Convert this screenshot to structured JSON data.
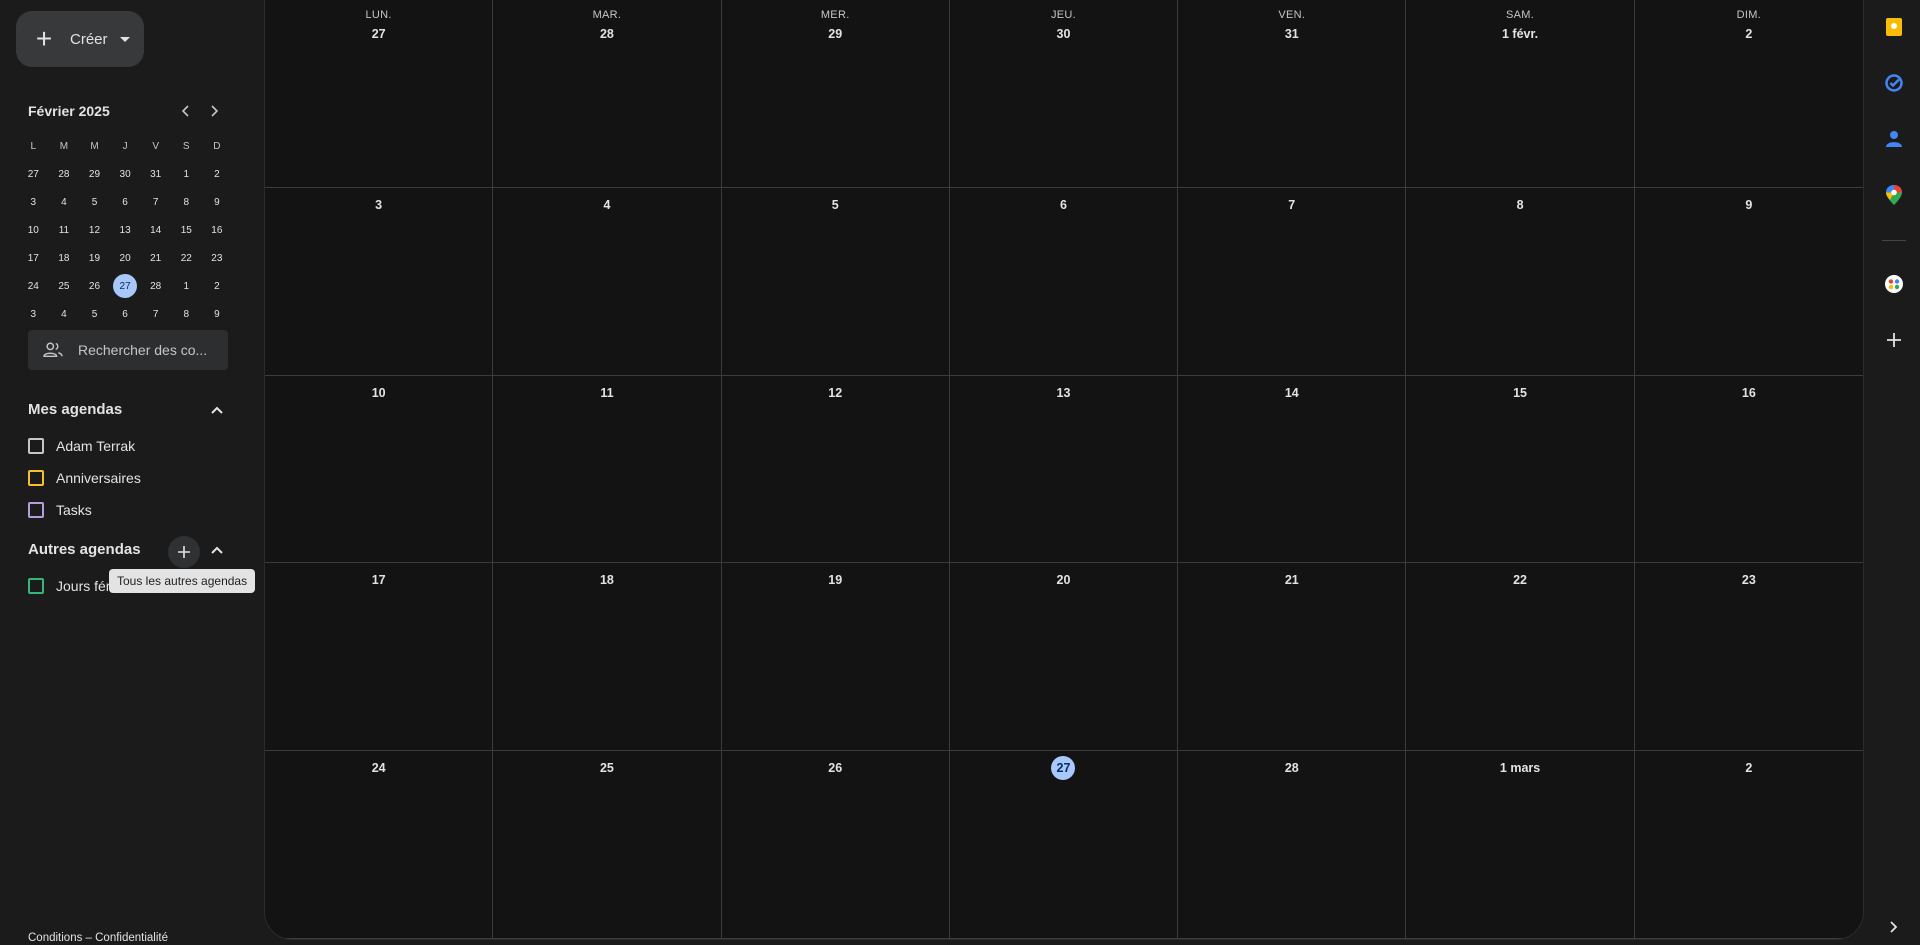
{
  "sidebar": {
    "create_label": "Créer",
    "mini": {
      "title": "Février 2025",
      "dows": [
        "L",
        "M",
        "M",
        "J",
        "V",
        "S",
        "D"
      ],
      "weeks": [
        [
          "27",
          "28",
          "29",
          "30",
          "31",
          "1",
          "2"
        ],
        [
          "3",
          "4",
          "5",
          "6",
          "7",
          "8",
          "9"
        ],
        [
          "10",
          "11",
          "12",
          "13",
          "14",
          "15",
          "16"
        ],
        [
          "17",
          "18",
          "19",
          "20",
          "21",
          "22",
          "23"
        ],
        [
          "24",
          "25",
          "26",
          "27",
          "28",
          "1",
          "2"
        ],
        [
          "3",
          "4",
          "5",
          "6",
          "7",
          "8",
          "9"
        ]
      ],
      "today_week": 4,
      "today_col": 3
    },
    "people_search_placeholder": "Rechercher des co...",
    "my_calendars": {
      "title": "Mes agendas",
      "items": [
        {
          "label": "Adam Terrak",
          "color": "#c4c7c5"
        },
        {
          "label": "Anniversaires",
          "color": "#f6bf26"
        },
        {
          "label": "Tasks",
          "color": "#b39ddb"
        }
      ]
    },
    "other_calendars": {
      "title": "Autres agendas",
      "items": [
        {
          "label": "Jours fériés",
          "color": "#33b679"
        }
      ]
    },
    "tooltip": "Tous les autres agendas",
    "footer": "Conditions – Confidentialité"
  },
  "month": {
    "dows": [
      "LUN.",
      "MAR.",
      "MER.",
      "JEU.",
      "VEN.",
      "SAM.",
      "DIM."
    ],
    "weeks": [
      [
        "27",
        "28",
        "29",
        "30",
        "31",
        "1 févr.",
        "2"
      ],
      [
        "3",
        "4",
        "5",
        "6",
        "7",
        "8",
        "9"
      ],
      [
        "10",
        "11",
        "12",
        "13",
        "14",
        "15",
        "16"
      ],
      [
        "17",
        "18",
        "19",
        "20",
        "21",
        "22",
        "23"
      ],
      [
        "24",
        "25",
        "26",
        "27",
        "28",
        "1 mars",
        "2"
      ]
    ],
    "today_week": 4,
    "today_col": 3
  },
  "rail": {
    "icons": [
      "keep-icon",
      "tasks-icon",
      "contacts-icon",
      "maps-icon",
      "addon-icon",
      "add-addon-icon",
      "expand-chevron-icon"
    ],
    "colors": {
      "keep": "#fbbc04",
      "tasks": "#4285f4",
      "contacts": "#4285f4"
    }
  }
}
